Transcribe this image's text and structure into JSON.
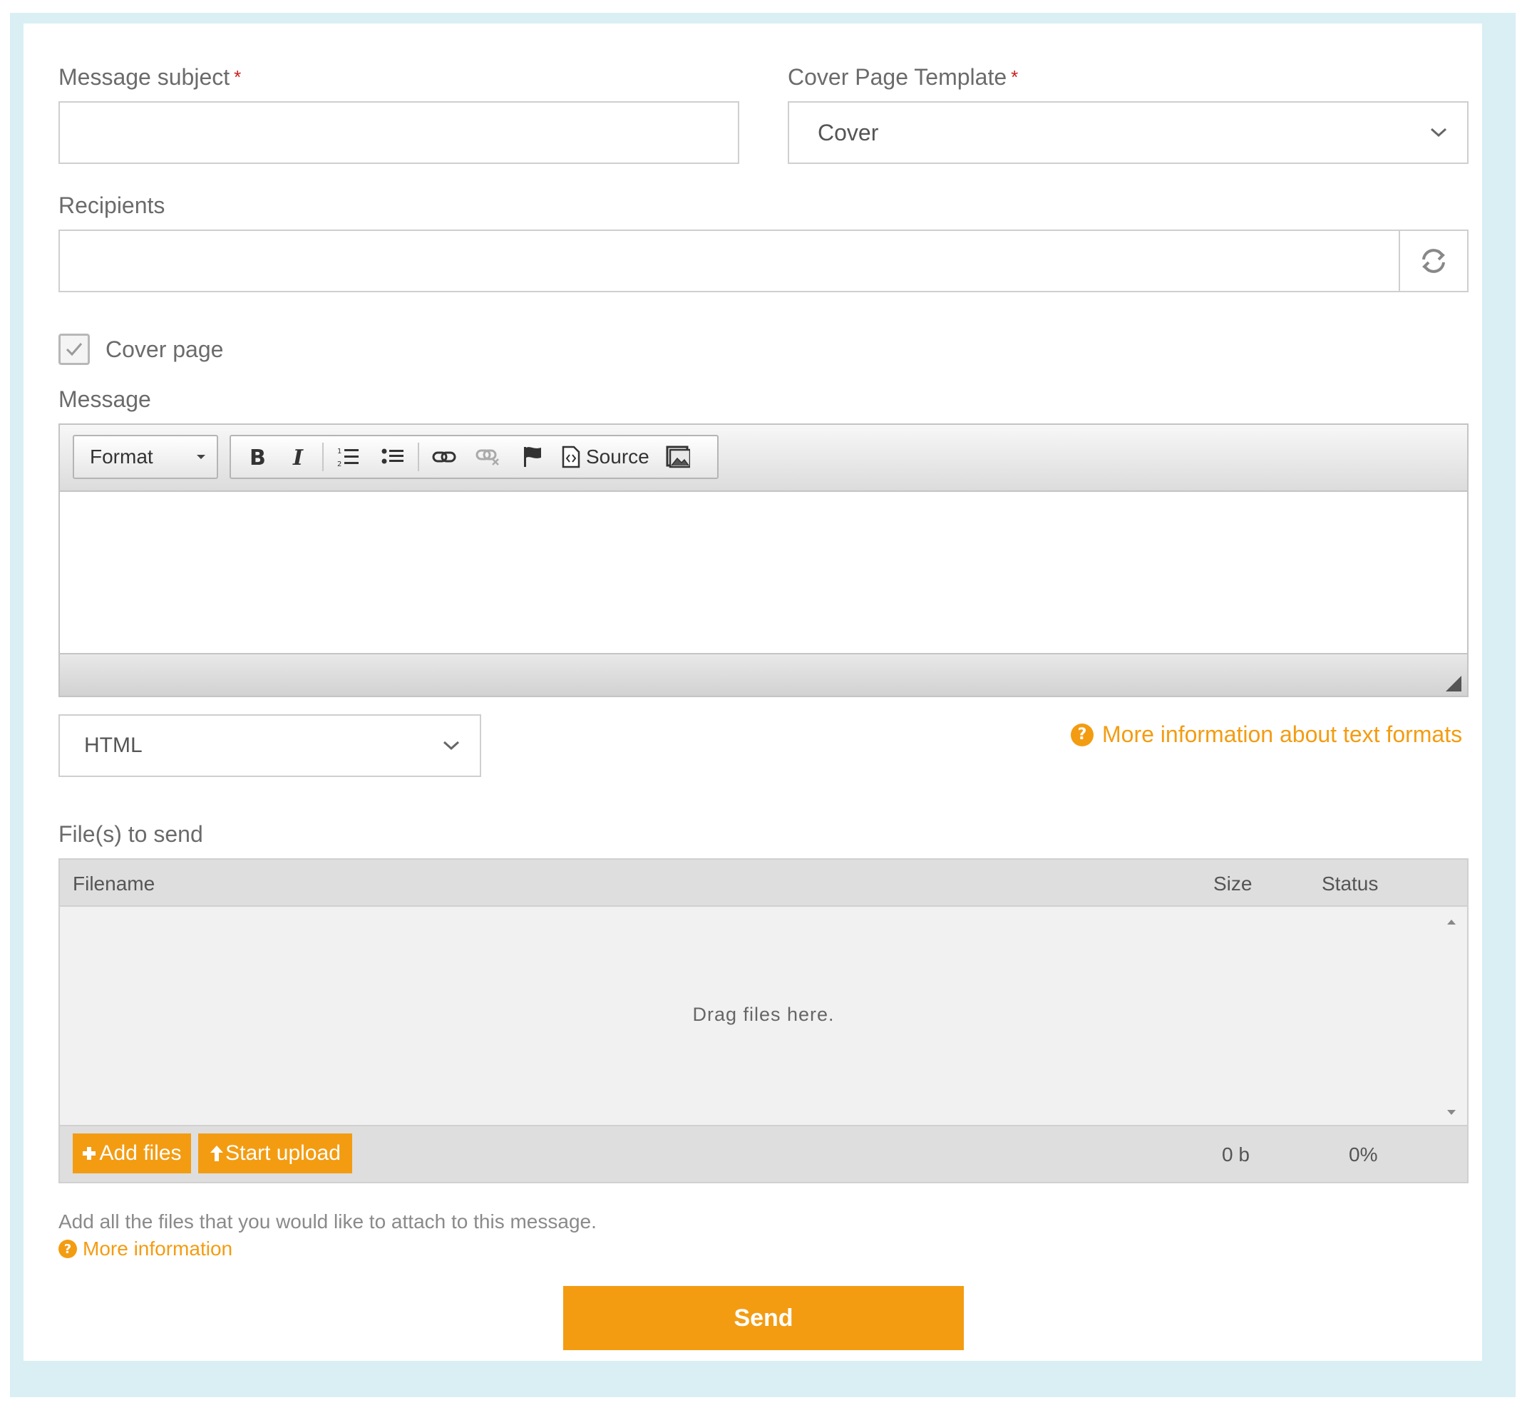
{
  "form": {
    "subject_label": "Message subject",
    "required_mark": "*",
    "cover_template_label": "Cover Page Template",
    "cover_template_value": "Cover",
    "recipients_label": "Recipients",
    "cover_page_label": "Cover page",
    "cover_page_checked": true,
    "message_label": "Message"
  },
  "editor": {
    "format_label": "Format",
    "source_label": "Source",
    "text_format_value": "HTML",
    "more_info_formats": "More information about text formats"
  },
  "files": {
    "section_label": "File(s) to send",
    "col_filename": "Filename",
    "col_size": "Size",
    "col_status": "Status",
    "drop_hint": "Drag files here.",
    "add_files_label": "Add files",
    "start_upload_label": "Start upload",
    "total_size": "0 b",
    "total_status": "0%",
    "help_text": "Add all the files that you would like to attach to this message.",
    "more_info": "More information"
  },
  "actions": {
    "send_label": "Send"
  },
  "colors": {
    "accent": "#f39c12",
    "frame": "#d9eff4",
    "required": "#cc1f1f"
  }
}
